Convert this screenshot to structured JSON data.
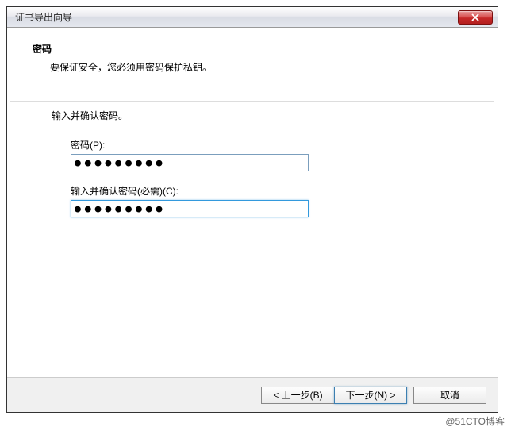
{
  "titlebar": {
    "title": "证书导出向导"
  },
  "content": {
    "heading": "密码",
    "subheading": "要保证安全，您必须用密码保护私钥。",
    "instruction": "输入并确认密码。",
    "password_label": "密码(P):",
    "password_value": "●●●●●●●●●",
    "confirm_label": "输入并确认密码(必需)(C):",
    "confirm_value": "●●●●●●●●●"
  },
  "buttons": {
    "back": "< 上一步(B)",
    "next": "下一步(N) >",
    "cancel": "取消"
  },
  "watermark": "@51CTO博客"
}
